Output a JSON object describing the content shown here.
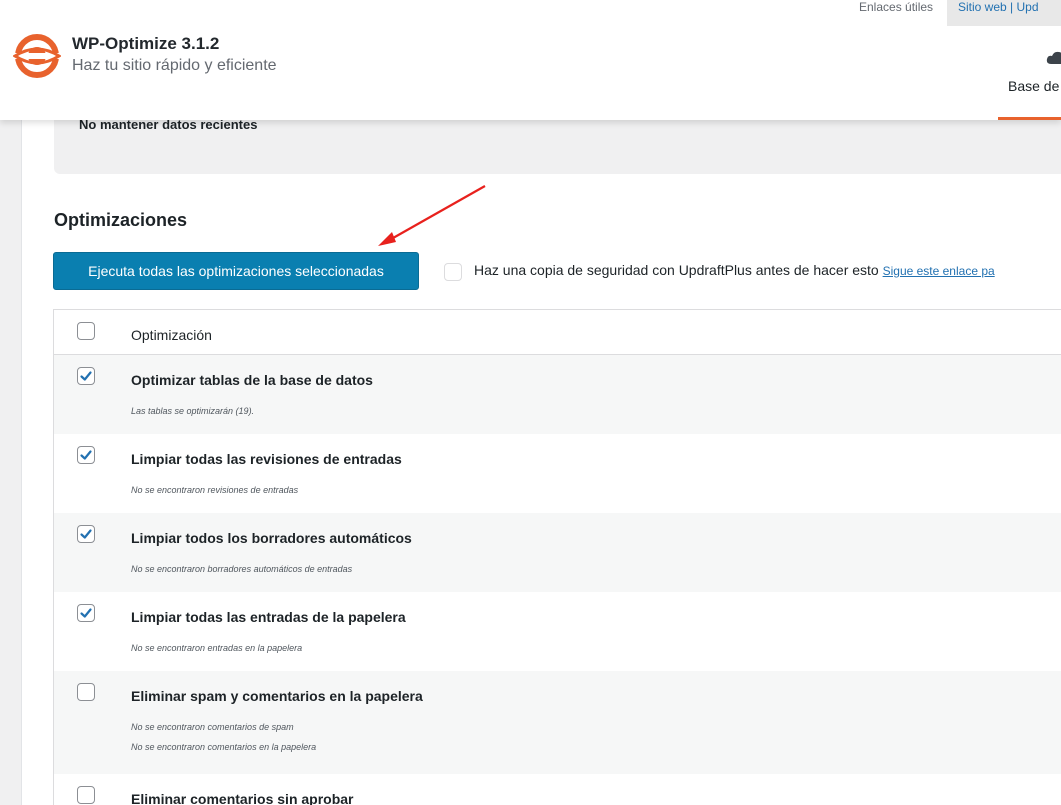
{
  "header": {
    "app_title": "WP-Optimize 3.1.2",
    "tagline": "Haz tu sitio rápido y eficiente",
    "link_useful": "Enlaces útiles",
    "link_web": "Sitio web | Upd",
    "tab_db": "Base de",
    "accent_color": "#e8622d"
  },
  "settings": {
    "recent_label": "No mantener datos recientes"
  },
  "optimizations": {
    "section_title": "Optimizaciones",
    "run_button": "Ejecuta todas las optimizaciones seleccionadas",
    "backup_text": "Haz una copia de seguridad con UpdraftPlus antes de hacer esto",
    "backup_link": "Sigue este enlace pa",
    "column_header": "Optimización",
    "rows": [
      {
        "title": "Optimizar tablas de la base de datos",
        "checked": true,
        "desc": [
          "Las tablas se optimizarán (19)."
        ]
      },
      {
        "title": "Limpiar todas las revisiones de entradas",
        "checked": true,
        "desc": [
          "No se encontraron revisiones de entradas"
        ]
      },
      {
        "title": "Limpiar todos los borradores automáticos",
        "checked": true,
        "desc": [
          "No se encontraron borradores automáticos de entradas"
        ]
      },
      {
        "title": "Limpiar todas las entradas de la papelera",
        "checked": true,
        "desc": [
          "No se encontraron entradas en la papelera"
        ]
      },
      {
        "title": "Eliminar spam y comentarios en la papelera",
        "checked": false,
        "desc": [
          "No se encontraron comentarios de spam",
          "No se encontraron comentarios en la papelera"
        ]
      },
      {
        "title": "Eliminar comentarios sin aprobar",
        "checked": false,
        "desc": []
      }
    ]
  }
}
